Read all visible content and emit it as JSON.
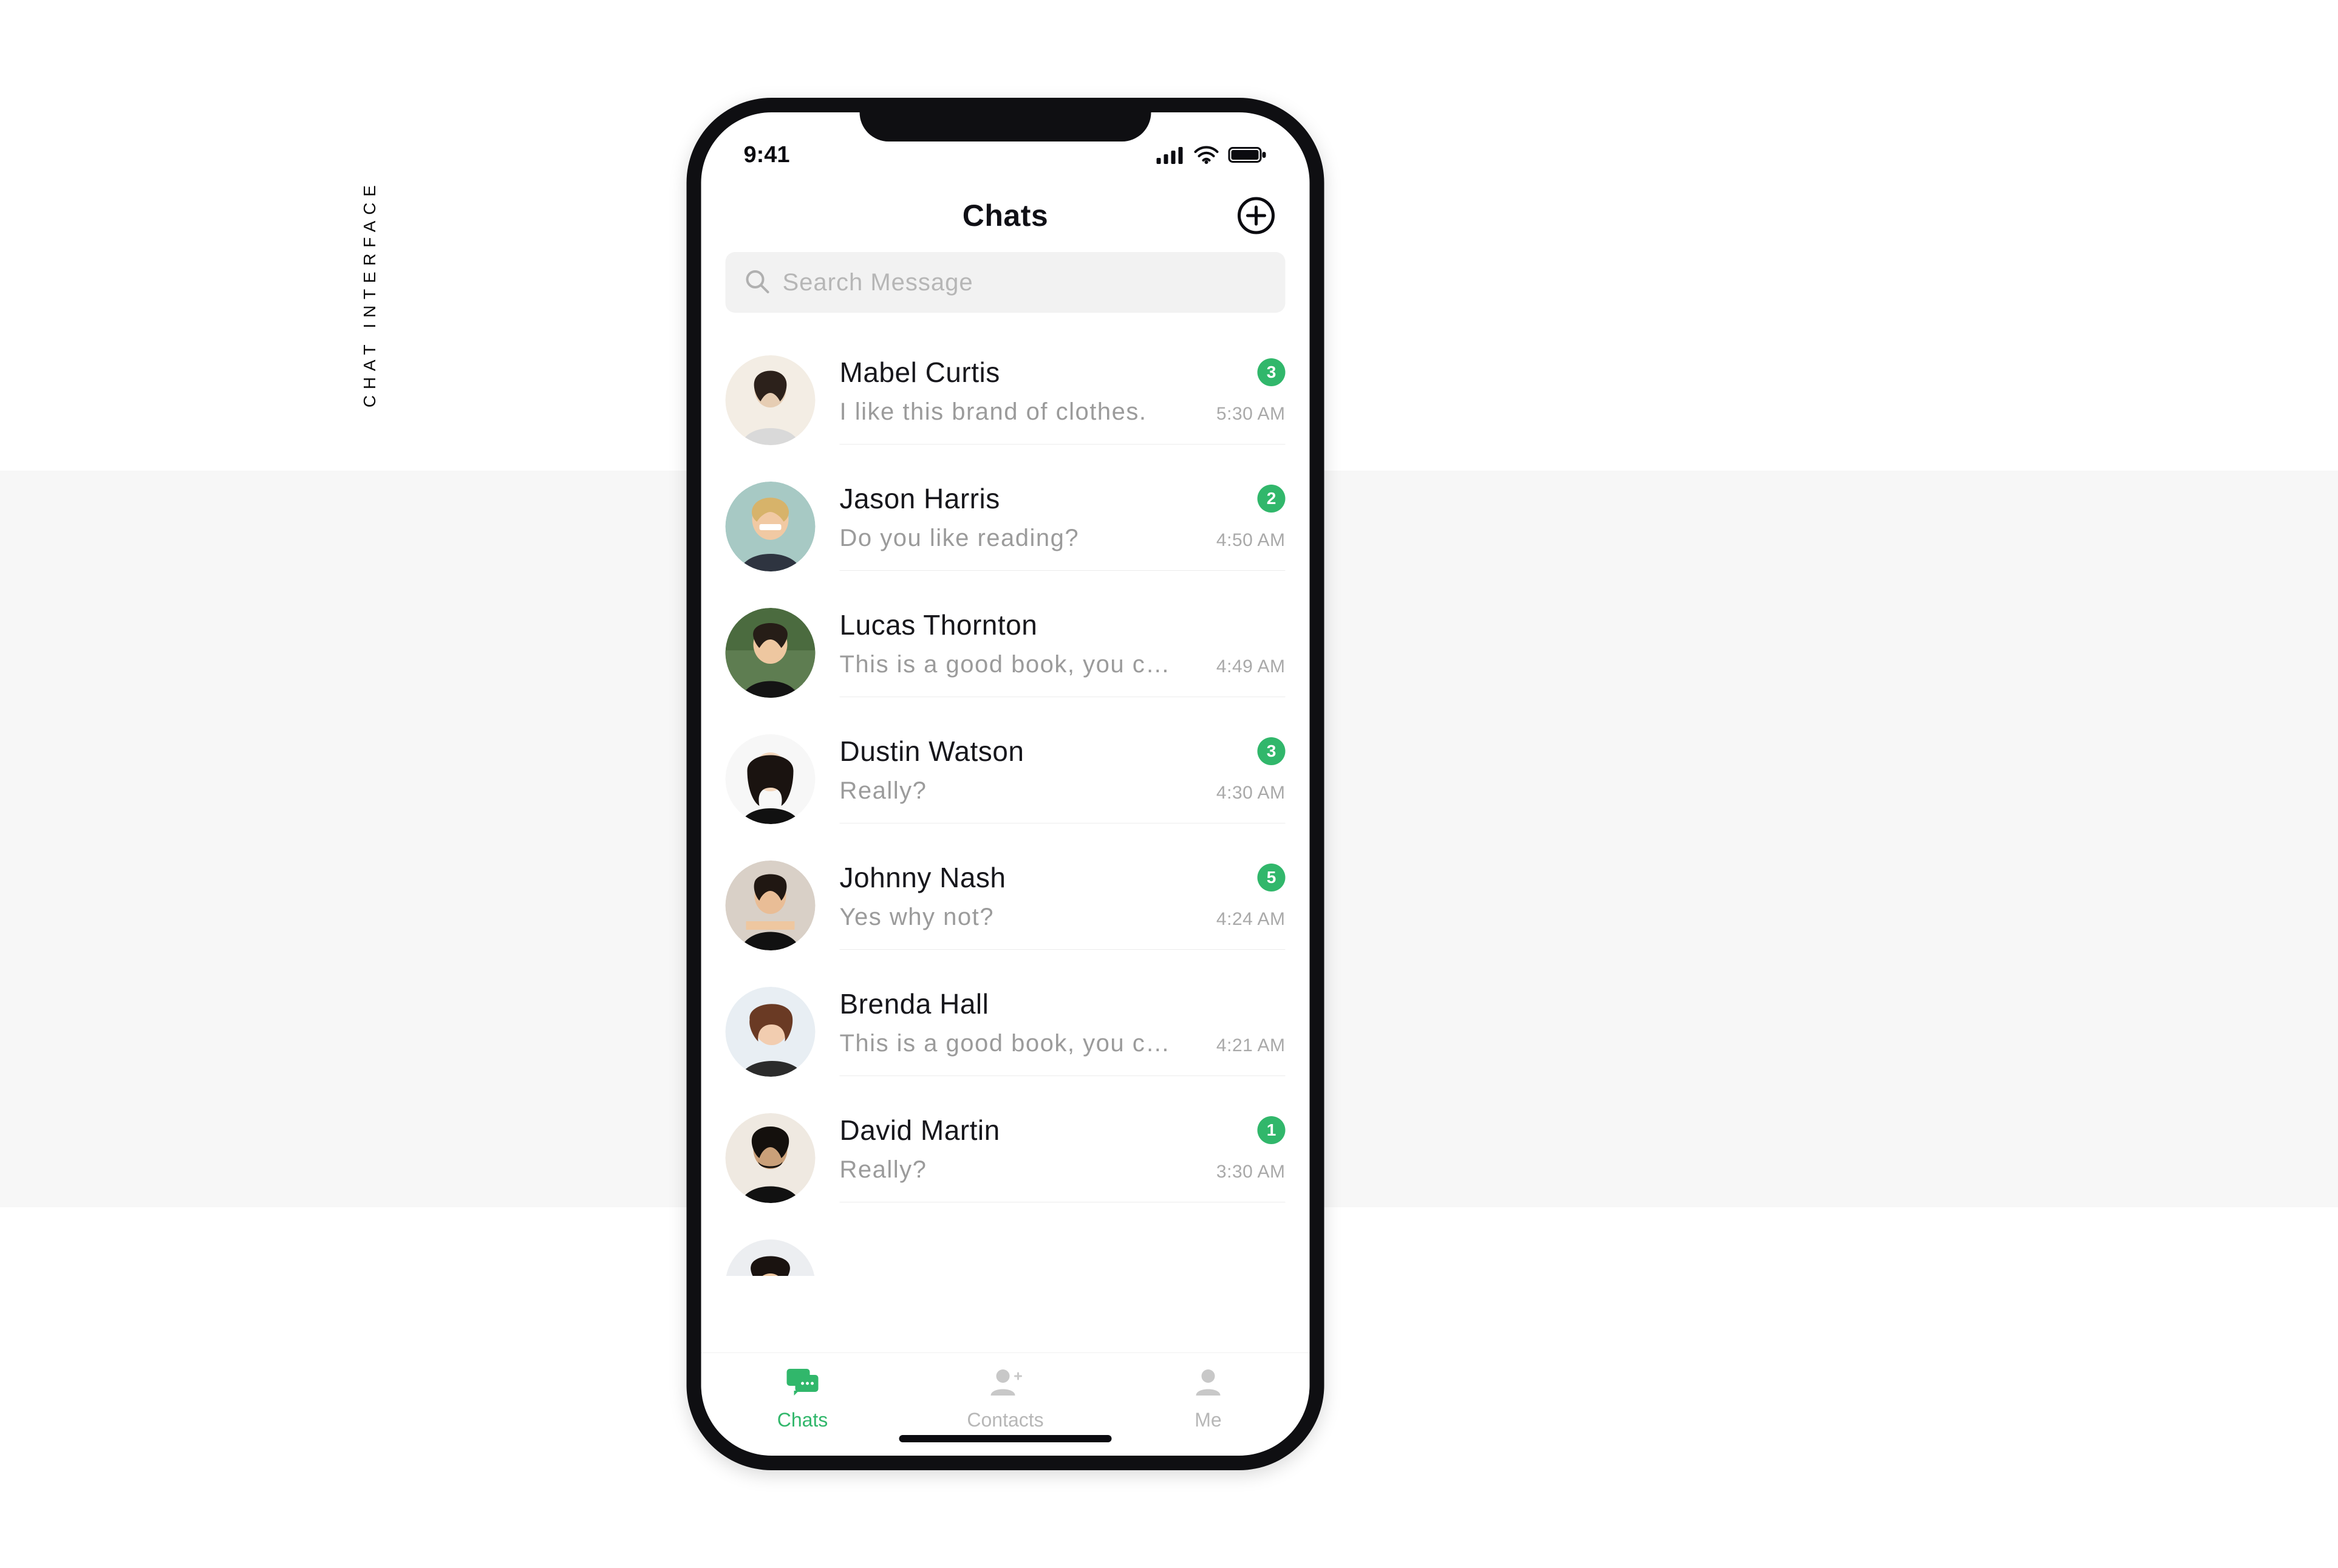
{
  "side_label": "CHAT INTERFACE",
  "status": {
    "time": "9:41"
  },
  "header": {
    "title": "Chats"
  },
  "search": {
    "placeholder": "Search Message"
  },
  "chats": [
    {
      "name": "Mabel Curtis",
      "msg": "I like this brand of clothes.",
      "time": "5:30 AM",
      "badge": "3"
    },
    {
      "name": "Jason Harris",
      "msg": "Do you like reading?",
      "time": "4:50 AM",
      "badge": "2"
    },
    {
      "name": "Lucas Thornton",
      "msg": "This is a good book, you c…",
      "time": "4:49 AM",
      "badge": ""
    },
    {
      "name": "Dustin Watson",
      "msg": "Really?",
      "time": "4:30 AM",
      "badge": "3"
    },
    {
      "name": "Johnny Nash",
      "msg": "Yes why not?",
      "time": "4:24 AM",
      "badge": "5"
    },
    {
      "name": "Brenda Hall",
      "msg": "This is a good book, you c…",
      "time": "4:21 AM",
      "badge": ""
    },
    {
      "name": "David Martin",
      "msg": "Really?",
      "time": "3:30 AM",
      "badge": "1"
    }
  ],
  "tabs": {
    "chats": {
      "label": "Chats"
    },
    "contacts": {
      "label": "Contacts"
    },
    "me": {
      "label": "Me"
    }
  },
  "colors": {
    "accent": "#31b76b"
  }
}
